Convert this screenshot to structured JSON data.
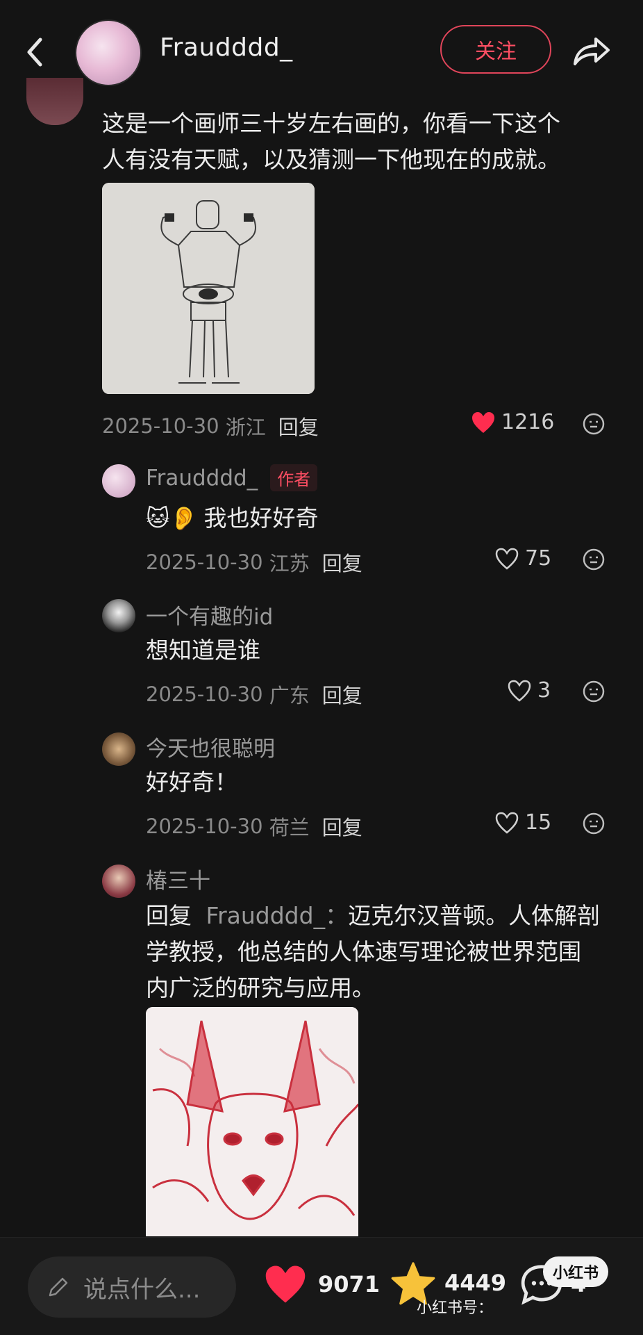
{
  "header": {
    "username": "Fraudddd_",
    "follow_label": "关注"
  },
  "main_comment": {
    "text_line1": "这是一个画师三十岁左右画的，你看一下这个",
    "text_line2": "人有没有天赋，以及猜测一下他现在的成就。",
    "date": "2025-10-30",
    "location": "浙江",
    "reply_label": "回复",
    "likes": "1216",
    "liked": true
  },
  "replies": [
    {
      "name": "Fraudddd_",
      "tag": "作者",
      "emoji": "🐱👂",
      "text": "我也好好奇",
      "date": "2025-10-30",
      "location": "江苏",
      "reply_label": "回复",
      "likes": "75"
    },
    {
      "name": "一个有趣的id",
      "text": "想知道是谁",
      "date": "2025-10-30",
      "location": "广东",
      "reply_label": "回复",
      "likes": "3"
    },
    {
      "name": "今天也很聪明",
      "text": "好好奇！",
      "date": "2025-10-30",
      "location": "荷兰",
      "reply_label": "回复",
      "likes": "15"
    },
    {
      "name": "椿三十",
      "reply_prefix": "回复",
      "reply_to": "Fraudddd_：",
      "text_line1": "迈克尔汉普顿。人体解剖",
      "text_line2": "学教授，他总结的人体速写理论被世界范围",
      "text_line3": "内广泛的研究与应用。"
    }
  ],
  "bottom_bar": {
    "input_placeholder": "说点什么...",
    "likes": "9071",
    "stars": "4449",
    "comments": "4"
  },
  "watermark": {
    "badge": "小红书",
    "id_label": "小红书号："
  },
  "colors": {
    "background": "#141414",
    "accent": "#ff4e63",
    "like_red": "#ff2d4f",
    "star_yellow": "#f7c23a"
  }
}
